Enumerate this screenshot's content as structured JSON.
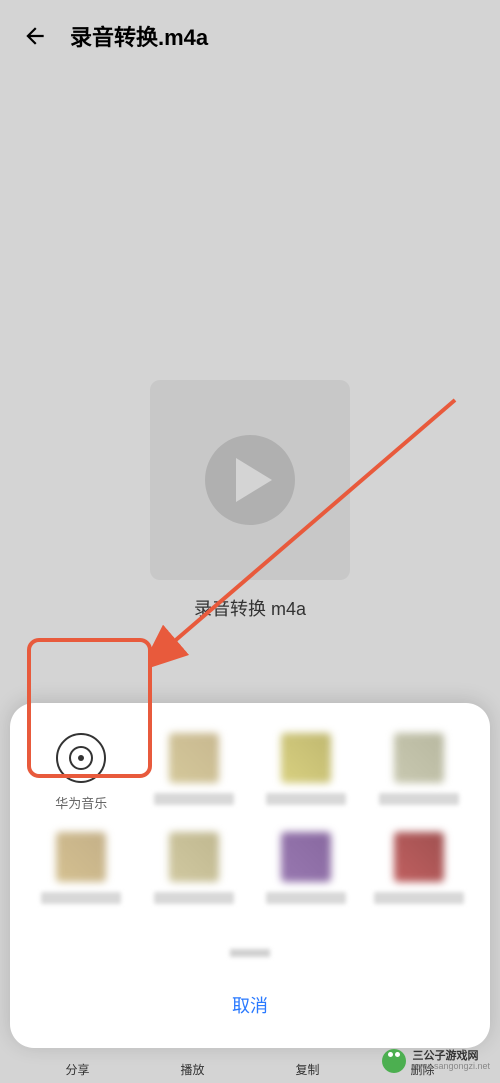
{
  "header": {
    "title": "录音转换.m4a"
  },
  "content": {
    "filename": "录音转换 m4a"
  },
  "share_sheet": {
    "items": [
      {
        "label": "华为音乐",
        "icon": "huawei-music"
      },
      {
        "label": "",
        "icon": "pixelated"
      },
      {
        "label": "",
        "icon": "pixelated"
      },
      {
        "label": "",
        "icon": "pixelated"
      },
      {
        "label": "",
        "icon": "pixelated"
      },
      {
        "label": "",
        "icon": "pixelated"
      },
      {
        "label": "",
        "icon": "pixelated"
      },
      {
        "label": "",
        "icon": "pixelated"
      }
    ],
    "cancel": "取消"
  },
  "bottom_tabs": [
    "分享",
    "播放",
    "复制",
    "删除"
  ],
  "watermark": {
    "title": "三公子游戏网",
    "url": "www.sangongzi.net"
  },
  "annotations": {
    "highlight_target": "华为音乐",
    "arrow_color": "#e85a3c"
  }
}
